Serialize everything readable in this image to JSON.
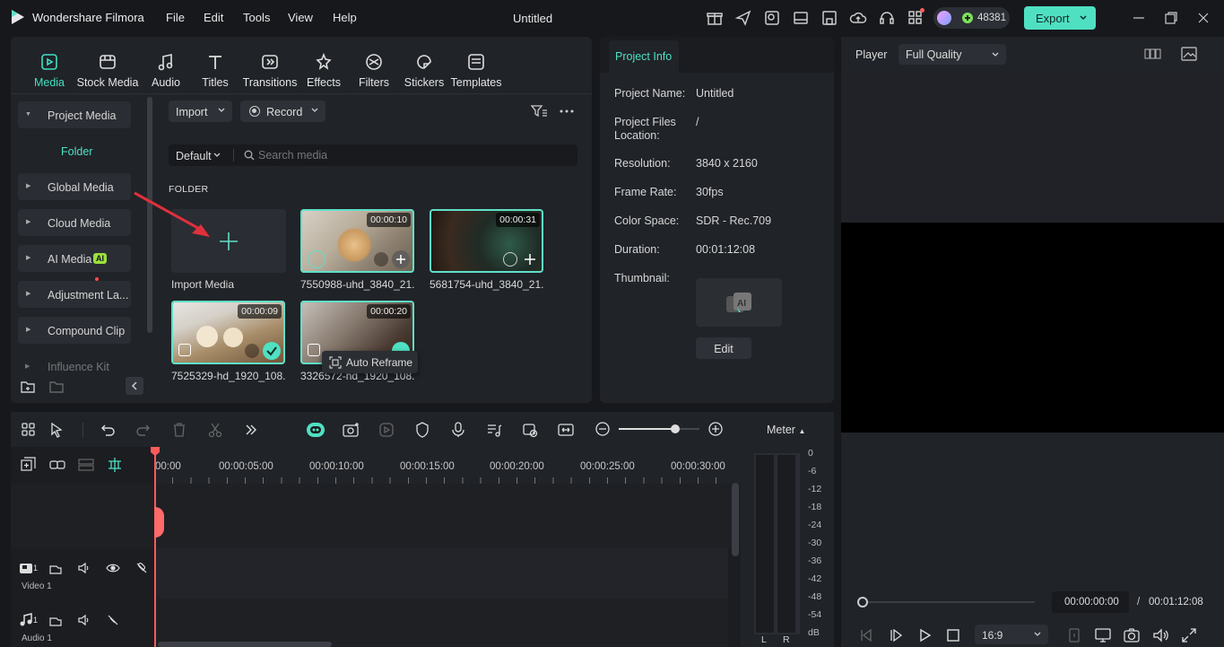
{
  "app": {
    "name": "Wondershare Filmora",
    "doc_title": "Untitled",
    "credits": "48381",
    "export_label": "Export"
  },
  "menu": [
    "File",
    "Edit",
    "Tools",
    "View",
    "Help"
  ],
  "toolbar": [
    {
      "label": "Media",
      "icon": "media-icon",
      "active": true
    },
    {
      "label": "Stock Media",
      "icon": "stock-media-icon"
    },
    {
      "label": "Audio",
      "icon": "audio-icon"
    },
    {
      "label": "Titles",
      "icon": "titles-icon"
    },
    {
      "label": "Transitions",
      "icon": "transitions-icon"
    },
    {
      "label": "Effects",
      "icon": "effects-icon"
    },
    {
      "label": "Filters",
      "icon": "filters-icon"
    },
    {
      "label": "Stickers",
      "icon": "stickers-icon"
    },
    {
      "label": "Templates",
      "icon": "templates-icon"
    }
  ],
  "sidebar": {
    "project_media": "Project Media",
    "folder": "Folder",
    "global_media": "Global Media",
    "cloud_media": "Cloud Media",
    "ai_media": "AI Media",
    "ai_badge": "AI",
    "adjustment": "Adjustment La...",
    "compound": "Compound Clip",
    "influence": "Influence Kit"
  },
  "media": {
    "import_btn": "Import",
    "record_btn": "Record",
    "sort": "Default",
    "search_placeholder": "Search media",
    "folder_heading": "FOLDER",
    "import_media": "Import Media",
    "tooltip": "Auto Reframe",
    "items": [
      {
        "name": "7550988-uhd_3840_21...",
        "duration": "00:00:10"
      },
      {
        "name": "5681754-uhd_3840_21...",
        "duration": "00:00:31"
      },
      {
        "name": "7525329-hd_1920_108...",
        "duration": "00:00:09"
      },
      {
        "name": "3326572-hd_1920_108...",
        "duration": "00:00:20"
      }
    ]
  },
  "project_info": {
    "tab": "Project Info",
    "rows": [
      {
        "label": "Project Name:",
        "value": "Untitled"
      },
      {
        "label": "Project Files Location:",
        "value": "/"
      },
      {
        "label": "Resolution:",
        "value": "3840 x 2160"
      },
      {
        "label": "Frame Rate:",
        "value": "30fps"
      },
      {
        "label": "Color Space:",
        "value": "SDR - Rec.709"
      },
      {
        "label": "Duration:",
        "value": "00:01:12:08"
      }
    ],
    "thumbnail_label": "Thumbnail:",
    "edit_btn": "Edit"
  },
  "player": {
    "label": "Player",
    "quality": "Full Quality",
    "current_time": "00:00:00:00",
    "sep": "/",
    "total_time": "00:01:12:08",
    "aspect": "16:9",
    "progress": 0
  },
  "timeline": {
    "ruler": [
      "00:00",
      "00:00:05:00",
      "00:00:10:00",
      "00:00:15:00",
      "00:00:20:00",
      "00:00:25:00",
      "00:00:30:00"
    ],
    "tracks": [
      {
        "num": "1",
        "name": "Video 1"
      },
      {
        "num": "1",
        "name": "Audio 1"
      }
    ],
    "meter_label": "Meter",
    "db_scale": [
      "0",
      "-6",
      "-12",
      "-18",
      "-24",
      "-30",
      "-36",
      "-42",
      "-48",
      "-54",
      "dB"
    ],
    "channels": [
      "L",
      "R"
    ],
    "zoom_level": 0.7
  }
}
